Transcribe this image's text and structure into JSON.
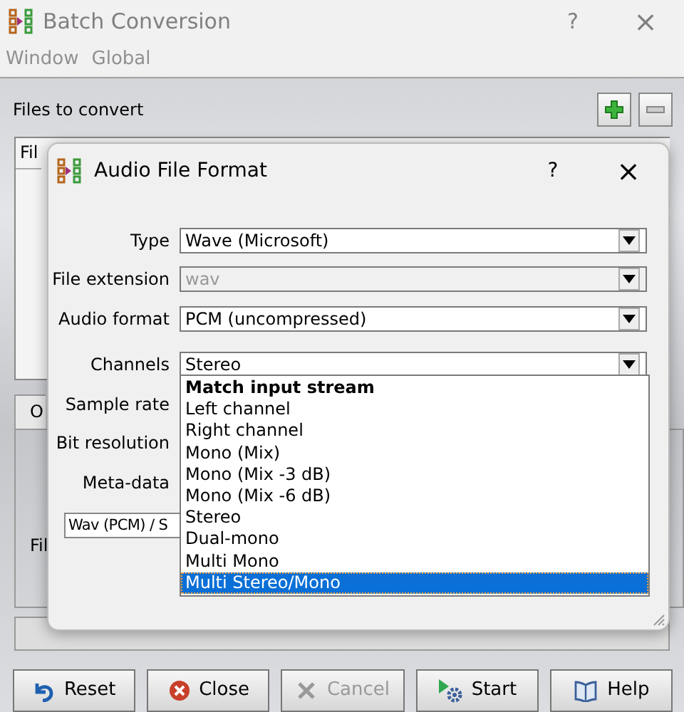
{
  "window": {
    "title": "Batch Conversion",
    "help": "?",
    "close": "×"
  },
  "menu": [
    "Window",
    "Global"
  ],
  "files": {
    "label": "Files to convert",
    "table_header": "Fil"
  },
  "left_fragments": {
    "tab": "O",
    "label": "Fil"
  },
  "dialog": {
    "title": "Audio File Format",
    "help": "?",
    "close": "×",
    "fields": [
      {
        "label": "Type",
        "value": "Wave (Microsoft)",
        "disabled": false
      },
      {
        "label": "File extension",
        "value": "wav",
        "disabled": true
      },
      {
        "label": "Audio format",
        "value": "PCM (uncompressed)",
        "disabled": false
      },
      {
        "label": "Channels",
        "value": "Stereo",
        "disabled": false
      }
    ],
    "hidden_rows": [
      "Sample rate",
      "Bit resolution",
      "Meta-data"
    ],
    "preset": "Wav (PCM) / S",
    "channel_options": [
      {
        "label": "Match input stream",
        "kind": "default",
        "selected": false
      },
      {
        "label": "Left channel",
        "kind": "option",
        "selected": false
      },
      {
        "label": "Right channel",
        "kind": "option",
        "selected": false
      },
      {
        "label": "Mono (Mix)",
        "kind": "option",
        "selected": false
      },
      {
        "label": "Mono (Mix -3 dB)",
        "kind": "option",
        "selected": false
      },
      {
        "label": "Mono (Mix -6 dB)",
        "kind": "option",
        "selected": false
      },
      {
        "label": "Stereo",
        "kind": "option",
        "selected": false
      },
      {
        "label": "Dual-mono",
        "kind": "option",
        "selected": false
      },
      {
        "label": "Multi Mono",
        "kind": "option",
        "selected": false
      },
      {
        "label": "Multi Stereo/Mono",
        "kind": "option",
        "selected": true
      }
    ]
  },
  "buttons": [
    {
      "label": "Reset",
      "kind": "reset",
      "disabled": false
    },
    {
      "label": "Close",
      "kind": "close",
      "disabled": false
    },
    {
      "label": "Cancel",
      "kind": "cancel",
      "disabled": true
    },
    {
      "label": "Start",
      "kind": "start",
      "disabled": false
    },
    {
      "label": "Help",
      "kind": "help",
      "disabled": false
    }
  ]
}
